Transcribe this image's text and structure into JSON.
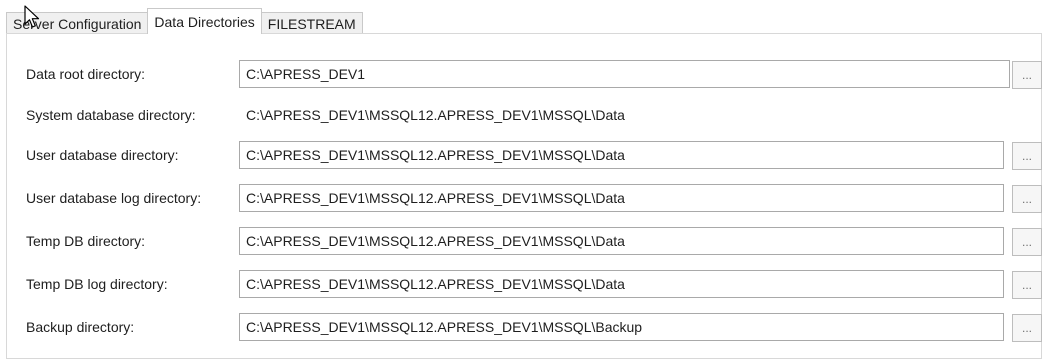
{
  "tabs": [
    {
      "label": "Server Configuration",
      "active": false
    },
    {
      "label": "Data Directories",
      "active": true
    },
    {
      "label": "FILESTREAM",
      "active": false
    }
  ],
  "browse_label": "...",
  "rows": [
    {
      "label": "Data root directory:",
      "value": "C:\\APRESS_DEV1",
      "editable": true
    },
    {
      "label": "System database directory:",
      "value": "C:\\APRESS_DEV1\\MSSQL12.APRESS_DEV1\\MSSQL\\Data",
      "editable": false
    },
    {
      "label": "User database directory:",
      "value": "C:\\APRESS_DEV1\\MSSQL12.APRESS_DEV1\\MSSQL\\Data",
      "editable": true
    },
    {
      "label": "User database log directory:",
      "value": "C:\\APRESS_DEV1\\MSSQL12.APRESS_DEV1\\MSSQL\\Data",
      "editable": true
    },
    {
      "label": "Temp DB directory:",
      "value": "C:\\APRESS_DEV1\\MSSQL12.APRESS_DEV1\\MSSQL\\Data",
      "editable": true
    },
    {
      "label": "Temp DB log directory:",
      "value": "C:\\APRESS_DEV1\\MSSQL12.APRESS_DEV1\\MSSQL\\Data",
      "editable": true
    },
    {
      "label": "Backup directory:",
      "value": "C:\\APRESS_DEV1\\MSSQL12.APRESS_DEV1\\MSSQL\\Backup",
      "editable": true
    }
  ]
}
